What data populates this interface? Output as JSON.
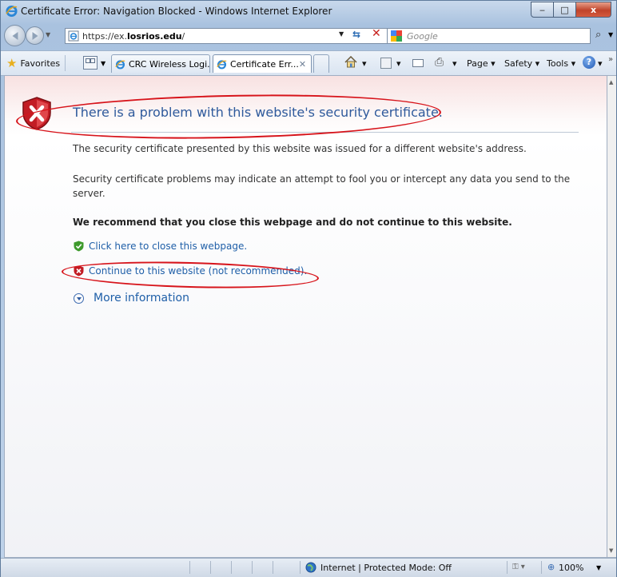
{
  "window": {
    "title": "Certificate Error: Navigation Blocked - Windows Internet Explorer",
    "min_label": "‒",
    "max_label": "□",
    "close_label": "x"
  },
  "address": {
    "url_prefix": "https://ex.",
    "url_host": "losrios.edu",
    "url_suffix": "/"
  },
  "search": {
    "placeholder": "Google"
  },
  "favorites": {
    "label": "Favorites"
  },
  "tabs": [
    {
      "label": "CRC Wireless Logi..."
    },
    {
      "label": "Certificate Err...",
      "close": "✕"
    }
  ],
  "commands": {
    "page": "Page",
    "safety": "Safety",
    "tools": "Tools",
    "help": "?"
  },
  "content": {
    "headline": "There is a problem with this website's security certificate.",
    "para1": "The security certificate presented by this website was issued for a different website's address.",
    "para2": "Security certificate problems may indicate an attempt to fool you or intercept any data you send to the server.",
    "recommend": "We recommend that you close this webpage and do not continue to this website.",
    "close_link": "Click here to close this webpage.",
    "continue_link": "Continue to this website (not recommended).",
    "more_info": "More information"
  },
  "status": {
    "zone": "Internet | Protected Mode: Off",
    "zoom": "100%"
  },
  "colors": {
    "link": "#1f5fa8",
    "headline": "#2e5a9c",
    "annotation": "#d7141b",
    "shield_red": "#c21c24",
    "shield_green": "#3e9a2c"
  }
}
